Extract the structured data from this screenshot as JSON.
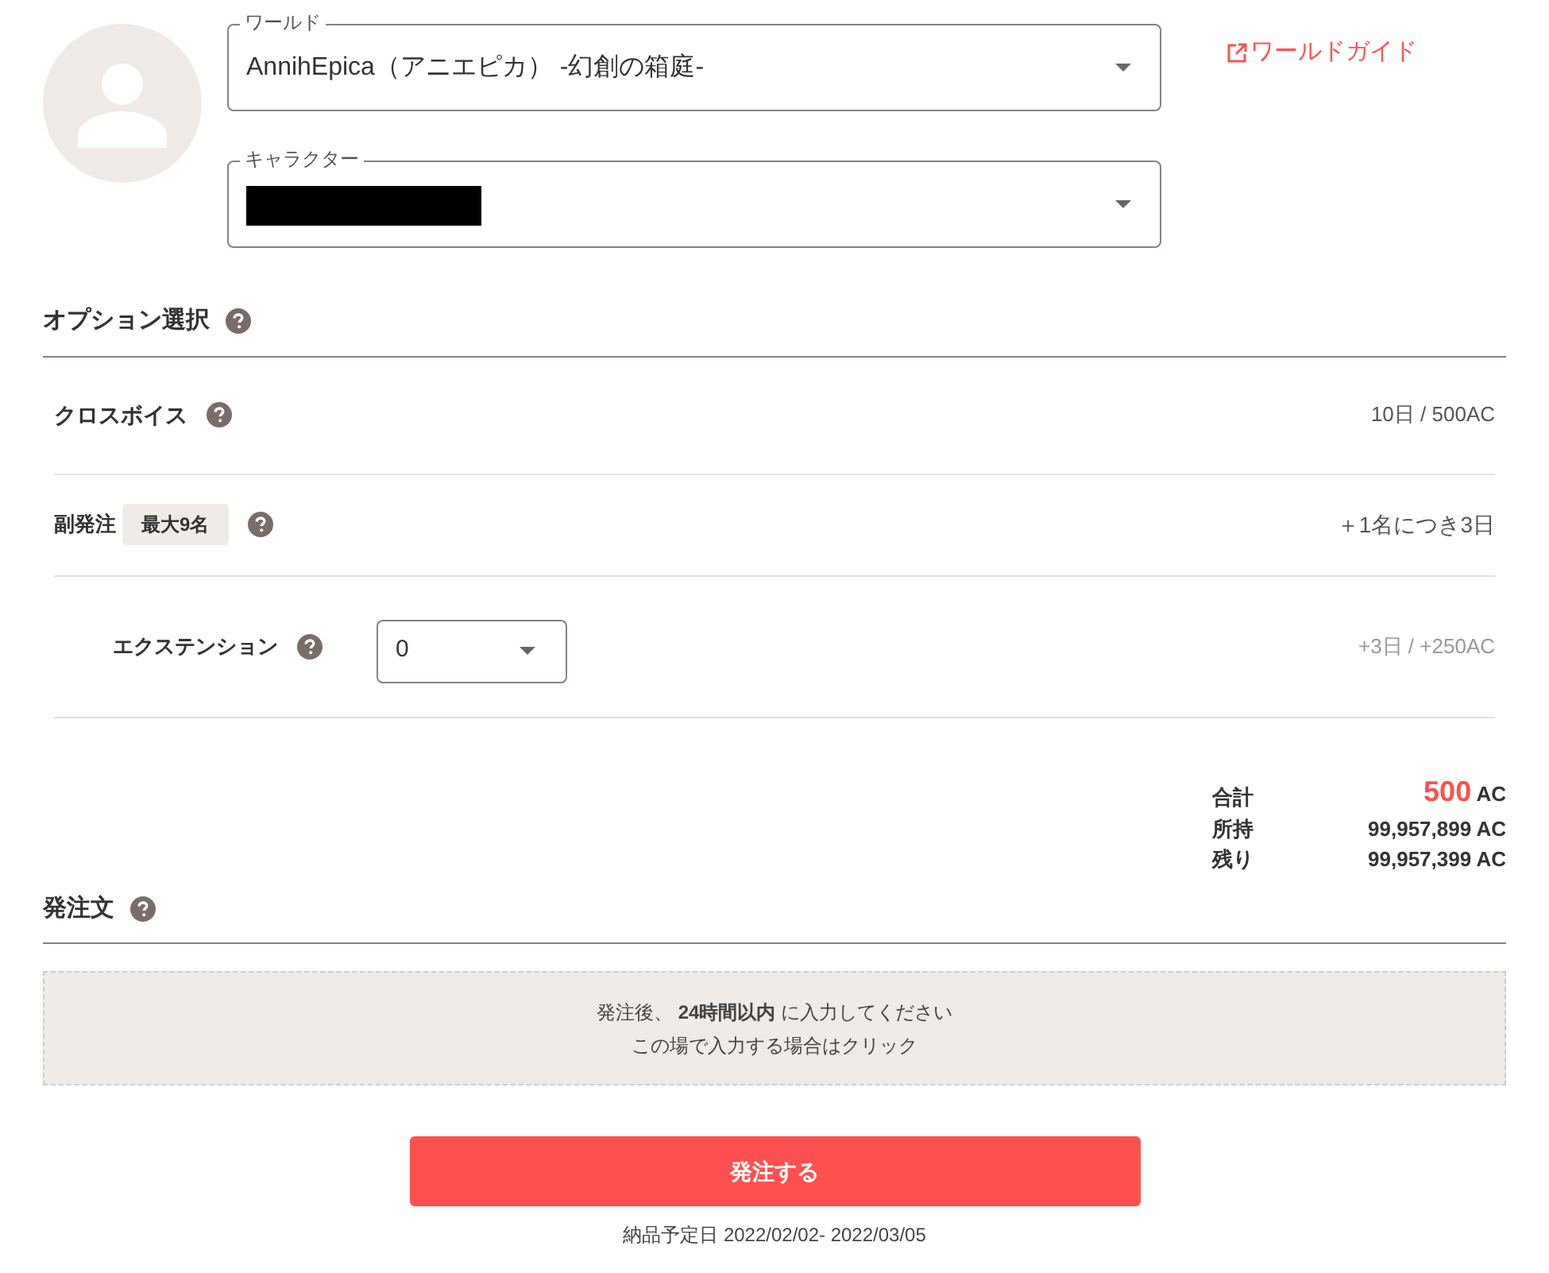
{
  "world_field": {
    "label": "ワールド",
    "value": "AnnihEpica（アニエピカ） -幻創の箱庭-"
  },
  "character_field": {
    "label": "キャラクター"
  },
  "guide_link": "ワールドガイド",
  "options": {
    "title": "オプション選択",
    "rows": [
      {
        "kind": "plain",
        "label": "クロスボイス",
        "detail": "10日 / 500AC"
      },
      {
        "kind": "badge",
        "label": "副発注",
        "badge": "最大9名",
        "detail": "＋1名につき3日"
      },
      {
        "kind": "select",
        "label": "エクステンション",
        "value": "0",
        "detail": "+3日 / +250AC"
      }
    ]
  },
  "totals": [
    {
      "label": "合計",
      "value": "500",
      "unit": "AC",
      "highlight": true
    },
    {
      "label": "所持",
      "value": "99,957,899",
      "unit": "AC",
      "highlight": false
    },
    {
      "label": "残り",
      "value": "99,957,399",
      "unit": "AC",
      "highlight": false
    }
  ],
  "order_text": {
    "title": "発注文",
    "lines": [
      "発注後、 **24時間以内** に入力してください",
      "この場で入力する場合はクリック"
    ]
  },
  "submit_button": "発注する",
  "delivery_date": "納品予定日 2022/02/02- 2022/03/05"
}
